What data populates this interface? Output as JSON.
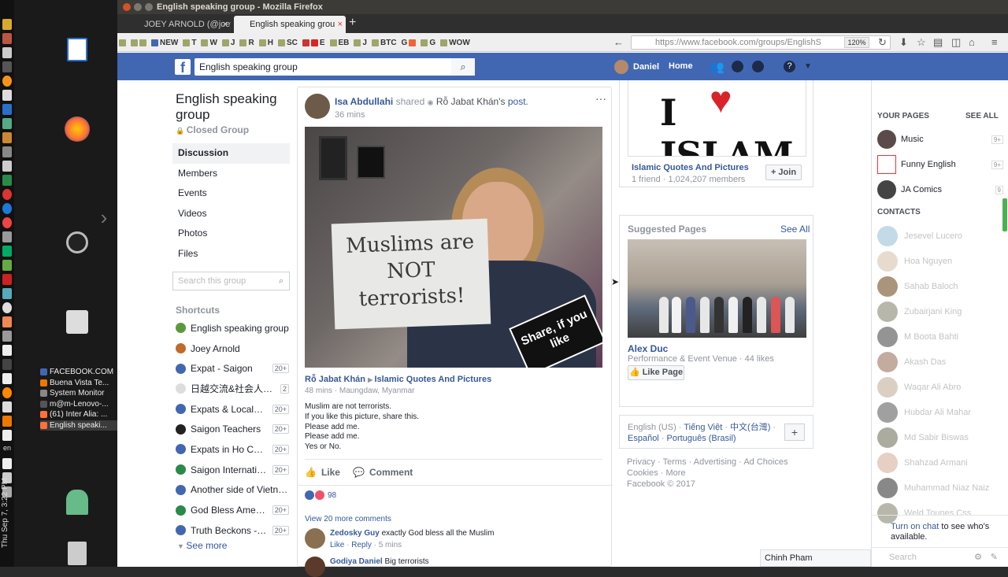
{
  "desktop": {
    "clock": "Thu Sep 7, 3:22 PM",
    "lang": "en",
    "tasks": [
      "FACEBOOK.COM",
      "Buena Vista Te...",
      "System Monitor",
      "m@m-Lenovo-...",
      "(61) Inter Alia: ...",
      "English speaki..."
    ]
  },
  "browser": {
    "window_title": "English speaking group - Mozilla Firefox",
    "tabs": [
      {
        "label": "JOEY ARNOLD (@joey"
      },
      {
        "label": "English speaking grou"
      }
    ],
    "new_tab": "+",
    "url": "https://www.facebook.com/groups/EnglishS",
    "zoom": "120%",
    "bookmarks": [
      "NEW",
      "T",
      "W",
      "J",
      "R",
      "H",
      "SC",
      "E",
      "EB",
      "J",
      "BTC",
      "G",
      "G",
      "WOW"
    ]
  },
  "fb": {
    "search_value": "English speaking group",
    "user_name": "Daniel",
    "home_label": "Home",
    "group": {
      "name": "English speaking group",
      "type": "Closed Group",
      "nav": [
        "Discussion",
        "Members",
        "Events",
        "Videos",
        "Photos",
        "Files"
      ],
      "search_placeholder": "Search this group",
      "shortcuts_title": "Shortcuts",
      "shortcuts": [
        {
          "label": "English speaking group",
          "count": ""
        },
        {
          "label": "Joey Arnold",
          "count": ""
        },
        {
          "label": "Expat - Saigon",
          "count": "20+"
        },
        {
          "label": "日越交流&社会人ボ...",
          "count": "2"
        },
        {
          "label": "Expats & Locals In ...",
          "count": "20+"
        },
        {
          "label": "Saigon Teachers",
          "count": "20+"
        },
        {
          "label": "Expats in Ho Chi Mi...",
          "count": "20+"
        },
        {
          "label": "Saigon Internation...",
          "count": "20+"
        },
        {
          "label": "Another side of Vietnam",
          "count": ""
        },
        {
          "label": "God Bless America...",
          "count": "20+"
        },
        {
          "label": "Truth Beckons - No...",
          "count": "20+"
        }
      ],
      "see_more": "See more"
    },
    "post": {
      "author": "Isa Abdullahi",
      "shared": "shared",
      "orig_author": "Rỗ Jabat Khán",
      "orig_suffix": "'s",
      "post_word": "post.",
      "time": "36 mins",
      "menu": "···",
      "image_sign": "Muslims are NOT terrorists!",
      "image_badge": "Share, if you like",
      "orig_page": "Islamic Quotes And Pictures",
      "orig_meta": "48 mins · Maungdaw, Myanmar",
      "text_lines": [
        "Muslim are not terrorists.",
        "If you like this picture, share this.",
        "Please add me.",
        "Please add me.",
        "Yes or No."
      ],
      "like_label": "Like",
      "comment_label": "Comment",
      "reactions_count": "98",
      "view_more": "View 20 more comments",
      "comments": [
        {
          "name": "Zedosky Guy",
          "text": "exactly God bless all the Muslim",
          "like": "Like",
          "reply": "Reply",
          "time": "5 mins"
        },
        {
          "name": "Godiya Daniel",
          "text": "Big terrorists"
        }
      ]
    },
    "right": {
      "islam_image_text": "I ISLAM",
      "islam_name": "Islamic Quotes And Pictures",
      "islam_members": "1 friend · 1,024,207 members",
      "join_label": "Join",
      "suggested_title": "Suggested Pages",
      "see_all": "See All",
      "page_name": "Alex Duc",
      "page_desc": "Performance & Event Venue · 44 likes",
      "like_page": "Like Page",
      "lang_current": "English (US)",
      "lang_links": [
        "Tiếng Việt",
        "中文(台灣)",
        "Español",
        "Português (Brasil)"
      ],
      "lang_plus": "+",
      "footer_line1": "Privacy · Terms · Advertising · Ad Choices",
      "footer_line2": "Cookies · More",
      "footer_line3": "Facebook © 2017"
    },
    "chat": {
      "your_pages": "YOUR PAGES",
      "see_all": "SEE ALL",
      "pages": [
        {
          "name": "Music",
          "count": "9+"
        },
        {
          "name": "Funny English",
          "count": "9+"
        },
        {
          "name": "JA Comics",
          "count": "9"
        }
      ],
      "contacts_title": "CONTACTS",
      "contacts": [
        "Jesevel Lucero",
        "Hoa Nguyen",
        "Sahab Baloch",
        "Zubairjani King",
        "M Boota Bahti",
        "Akash Das",
        "Waqar Ali Abro",
        "Hubdar Ali Mahar",
        "Md Sabir Biswas",
        "Shahzad Armani",
        "Muhammad Niaz Naiz",
        "Weld Tounes Css"
      ],
      "turn_on": "Turn on chat",
      "turn_on_rest": "to see who's available.",
      "search_placeholder": "Search",
      "chat_tab": "Chinh Pham"
    }
  }
}
